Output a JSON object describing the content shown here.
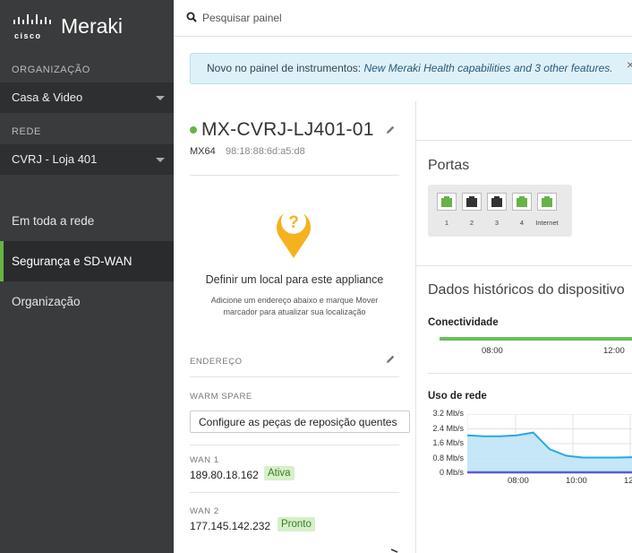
{
  "brand": {
    "cisco": "cisco",
    "product": "Meraki"
  },
  "sidebar": {
    "org_label": "ORGANIZAÇÃO",
    "org_value": "Casa & Video",
    "network_label": "REDE",
    "network_value": "CVRJ - Loja 401",
    "items": [
      {
        "label": "Em toda a rede",
        "active": false
      },
      {
        "label": "Segurança e SD-WAN",
        "active": true
      },
      {
        "label": "Organização",
        "active": false
      }
    ]
  },
  "search": {
    "placeholder": "Pesquisar painel"
  },
  "banner": {
    "text": "Novo no painel de instrumentos: ",
    "link": "New Meraki Health capabilities and 3 other features.",
    "close": "×"
  },
  "device": {
    "name": "MX-CVRJ-LJ401-01",
    "model": "MX64",
    "mac": "98:18:88:6d:a5:d8",
    "status_color": "#67b346"
  },
  "location": {
    "title": "Definir um local para este appliance",
    "description": "Adicione um endereço abaixo e marque Mover marcador para atualizar sua localização"
  },
  "address": {
    "label": "ENDEREÇO"
  },
  "warm_spare": {
    "label": "WARM SPARE",
    "button": "Configure as peças de reposição quentes"
  },
  "wan1": {
    "label": "WAN 1",
    "ip": "189.80.18.162",
    "status": "Ativa"
  },
  "wan2": {
    "label": "WAN 2",
    "ip": "177.145.142.232",
    "status": "Pronto"
  },
  "ports": {
    "title": "Portas",
    "items": [
      {
        "label": "1",
        "state": "active",
        "color": "#67b346"
      },
      {
        "label": "2",
        "state": "inactive",
        "color": "#333333"
      },
      {
        "label": "3",
        "state": "inactive",
        "color": "#333333"
      },
      {
        "label": "4",
        "state": "active",
        "color": "#67b346"
      },
      {
        "label": "Internet",
        "state": "active",
        "color": "#67b346"
      }
    ]
  },
  "history": {
    "title": "Dados históricos do dispositivo",
    "connectivity_label": "Conectividade",
    "connectivity_ticks": [
      "08:00",
      "12:00"
    ],
    "usage_label": "Uso de rede"
  },
  "chart_data": {
    "type": "area",
    "title": "Uso de rede",
    "y_ticks": [
      "3.2 Mb/s",
      "2.4 Mb/s",
      "1.6 Mb/s",
      "0.8 Mb/s",
      "0 Mb/s"
    ],
    "x_ticks": [
      "08:00",
      "10:00",
      "12"
    ],
    "ylim": [
      0,
      3.2
    ],
    "series": [
      {
        "color": "#29a8e0",
        "values": [
          2.05,
          2.0,
          2.0,
          2.05,
          2.2,
          1.3,
          0.95,
          0.85,
          0.85,
          0.85,
          0.87
        ]
      },
      {
        "color": "#5b5bd6",
        "values": [
          0.05,
          0.05,
          0.05,
          0.05,
          0.05,
          0.05,
          0.05,
          0.05,
          0.05,
          0.05,
          0.05
        ]
      }
    ]
  }
}
